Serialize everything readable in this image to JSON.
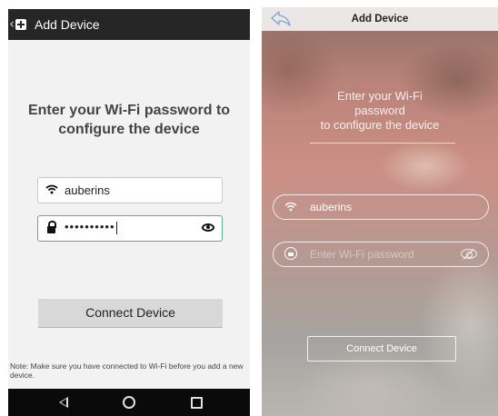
{
  "android": {
    "app_bar": {
      "back_glyph": "‹",
      "icon": "add-box-icon",
      "title": "Add Device"
    },
    "heading": "Enter your Wi-Fi password to configure the device",
    "ssid_field": {
      "icon": "wifi-icon",
      "value": "auberins"
    },
    "password_field": {
      "icon": "lock-icon",
      "value": "••••••••••",
      "visibility_icon": "eye-icon"
    },
    "connect_button": "Connect Device",
    "note": "Note: Make sure you have connected to Wi-Fi before you add a new device.",
    "nav_bar": {
      "back": "nav-back-icon",
      "home": "nav-home-icon",
      "recents": "nav-recents-icon"
    }
  },
  "ios": {
    "nav_bar": {
      "back_icon": "back-arrow-icon",
      "title": "Add Device"
    },
    "heading_line1": "Enter your Wi-Fi",
    "heading_line2": "password",
    "heading_line3": "to configure the device",
    "ssid_field": {
      "icon": "wifi-icon",
      "value": "auberins"
    },
    "password_field": {
      "icon": "lock-icon",
      "placeholder": "Enter Wi-Fi password",
      "visibility_icon": "eye-off-icon"
    },
    "connect_button": "Connect Device"
  },
  "colors": {
    "android_appbar": "#262626",
    "android_focus": "#4fb487",
    "android_button": "#d8d8d8",
    "ios_accent": "#7aa6d6"
  }
}
